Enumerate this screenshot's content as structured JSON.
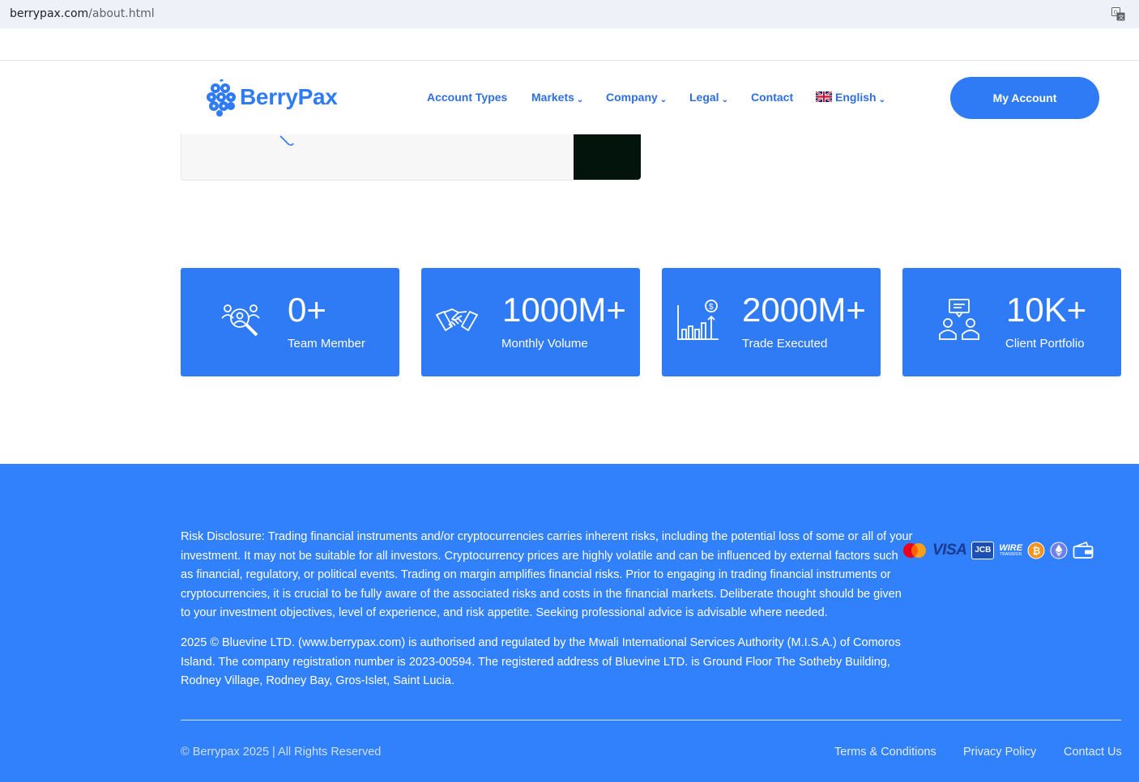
{
  "browser": {
    "url_domain": "berrypax.com",
    "url_path": "/about.html"
  },
  "header": {
    "logo_text": "BerryPax",
    "nav": {
      "account_types": "Account Types",
      "markets": "Markets",
      "company": "Company",
      "legal": "Legal",
      "contact": "Contact",
      "language": "English"
    },
    "my_account": "My Account"
  },
  "stats": [
    {
      "value": "0+",
      "label": "Team Member",
      "icon": "team-search-icon"
    },
    {
      "value": "1000M+",
      "label": "Monthly Volume",
      "icon": "handshake-icon"
    },
    {
      "value": "2000M+",
      "label": "Trade Executed",
      "icon": "growth-chart-icon"
    },
    {
      "value": "10K+",
      "label": "Client Portfolio",
      "icon": "client-portfolio-icon"
    }
  ],
  "footer": {
    "risk_disclosure": "Risk Disclosure: Trading financial instruments and/or cryptocurrencies carries inherent risks, including the potential loss of some or all of your investment. It may not be suitable for all investors. Cryptocurrency prices are highly volatile and can be influenced by external factors such as financial, regulatory, or political events. Trading on margin amplifies financial risks. Prior to engaging in trading financial instruments or cryptocurrencies, it is crucial to be fully aware of the associated risks and costs in the financial markets. Deliberate thought should be given to your investment objectives, level of experience, and risk appetite. Seeking professional advice is advisable where needed.",
    "company_info": "2025 © Bluevine LTD. (www.berrypax.com) is authorised and regulated by the Mwali International Services Authority (M.I.S.A.) of Comoros Island. The company registration number is 2023-00594. The registered address of Bluevine LTD. is Ground Floor The Sotheby Building, Rodney Village, Rodney Bay, Gros-Islet, Saint Lucia.",
    "payment_icons": {
      "visa_text": "VISA",
      "jcb_text": "JCB",
      "wire_text": "WIRE",
      "wire_sub": "TRANSFER"
    },
    "copyright": "© Berrypax 2025 | All Rights Reserved",
    "links": {
      "terms": "Terms & Conditions",
      "privacy": "Privacy Policy",
      "contact": "Contact Us"
    }
  },
  "colors": {
    "brand_blue": "#2f7bf5",
    "footer_blue": "#3180fc",
    "nav_text": "#2f6fe0"
  }
}
